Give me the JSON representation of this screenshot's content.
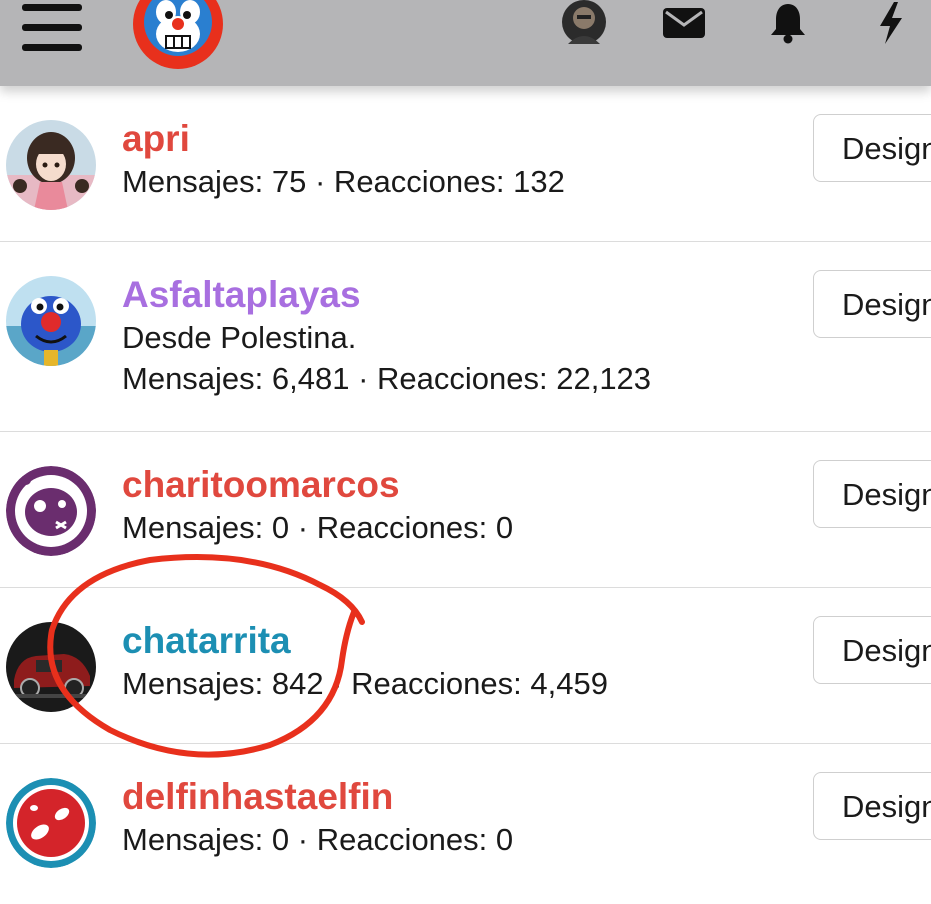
{
  "topbar": {
    "menu_icon": "hamburger-icon",
    "logo": "site-logo",
    "avatar": "user-avatar",
    "icons": [
      "envelope-icon",
      "bell-icon",
      "lightning-icon"
    ]
  },
  "members": [
    {
      "name": "apri",
      "name_color": "#e0483e",
      "lines": [
        "Mensajes: 75 · Reacciones: 132"
      ],
      "button": "Design"
    },
    {
      "name": "Asfaltaplayas",
      "name_color": "#a86fe0",
      "lines": [
        "Desde Polestina.",
        "Mensajes: 6,481 · Reacciones: 22,123"
      ],
      "button": "Design"
    },
    {
      "name": "charitoomarcos",
      "name_color": "#e0483e",
      "lines": [
        "Mensajes: 0 · Reacciones: 0"
      ],
      "button": "Design"
    },
    {
      "name": "chatarrita",
      "name_color": "#1c8fb3",
      "lines": [
        "Mensajes: 842 · Reacciones: 4,459"
      ],
      "button": "Design"
    },
    {
      "name": "delfinhastaelfin",
      "name_color": "#e0483e",
      "lines": [
        "Mensajes: 0 · Reacciones: 0"
      ],
      "button": "Design"
    }
  ],
  "annotation": {
    "color": "#e8301c"
  }
}
